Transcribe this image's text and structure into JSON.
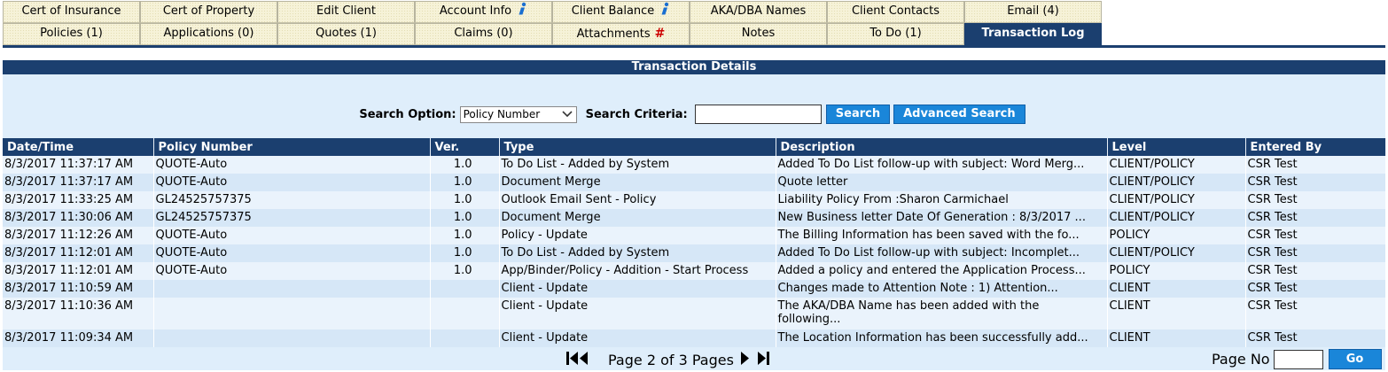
{
  "tabs": {
    "row1": [
      {
        "label": "Cert of Insurance"
      },
      {
        "label": "Cert of Property"
      },
      {
        "label": "Edit Client"
      },
      {
        "label": "Account Info",
        "icon": "info-icon"
      },
      {
        "label": "Client Balance",
        "icon": "info-icon"
      },
      {
        "label": "AKA/DBA Names"
      },
      {
        "label": "Client Contacts"
      },
      {
        "label": "Email (4)"
      }
    ],
    "row2": [
      {
        "label": "Policies (1)"
      },
      {
        "label": "Applications (0)"
      },
      {
        "label": "Quotes (1)"
      },
      {
        "label": "Claims (0)"
      },
      {
        "label": "Attachments",
        "icon": "hash-icon",
        "icon_text": "#"
      },
      {
        "label": "Notes"
      },
      {
        "label": "To Do (1)"
      },
      {
        "label": "Transaction Log",
        "active": true
      }
    ]
  },
  "panel": {
    "title": "Transaction Details",
    "search": {
      "option_label": "Search Option:",
      "option_value": "Policy Number",
      "criteria_label": "Search Criteria:",
      "criteria_value": "",
      "search_button": "Search",
      "advanced_button": "Advanced Search"
    }
  },
  "table": {
    "columns": [
      "Date/Time",
      "Policy Number",
      "Ver.",
      "Type",
      "Description",
      "Level",
      "Entered By"
    ],
    "rows": [
      [
        "8/3/2017 11:37:17 AM",
        "QUOTE-Auto",
        "1.0",
        "To Do List - Added by System",
        "Added To Do List follow-up with subject: Word Merg...",
        "CLIENT/POLICY",
        "CSR Test"
      ],
      [
        "8/3/2017 11:37:17 AM",
        "QUOTE-Auto",
        "1.0",
        "Document Merge",
        "Quote letter",
        "CLIENT/POLICY",
        "CSR Test"
      ],
      [
        "8/3/2017 11:33:25 AM",
        "GL24525757375",
        "1.0",
        "Outlook Email Sent - Policy",
        "Liability Policy From :Sharon Carmichael",
        "CLIENT/POLICY",
        "CSR Test"
      ],
      [
        "8/3/2017 11:30:06 AM",
        "GL24525757375",
        "1.0",
        "Document Merge",
        "New Business letter Date Of Generation : 8/3/2017 ...",
        "CLIENT/POLICY",
        "CSR Test"
      ],
      [
        "8/3/2017 11:12:26 AM",
        "QUOTE-Auto",
        "1.0",
        "Policy - Update",
        "The Billing Information has been saved with the fo...",
        "POLICY",
        "CSR Test"
      ],
      [
        "8/3/2017 11:12:01 AM",
        "QUOTE-Auto",
        "1.0",
        "To Do List - Added by System",
        "Added To Do List follow-up with subject: Incomplet...",
        "CLIENT/POLICY",
        "CSR Test"
      ],
      [
        "8/3/2017 11:12:01 AM",
        "QUOTE-Auto",
        "1.0",
        "App/Binder/Policy - Addition - Start Process",
        "Added a policy and entered the Application Process...",
        "POLICY",
        "CSR Test"
      ],
      [
        "8/3/2017 11:10:59 AM",
        "",
        "",
        "Client - Update",
        "Changes made to Attention Note : 1) Attention...",
        "CLIENT",
        "CSR Test"
      ],
      [
        "8/3/2017 11:10:36 AM",
        "",
        "",
        "Client - Update",
        "The AKA/DBA Name has been added with the following...",
        "CLIENT",
        "CSR Test"
      ],
      [
        "8/3/2017 11:09:34 AM",
        "",
        "",
        "Client - Update",
        "The Location Information has been successfully add...",
        "CLIENT",
        "CSR Test"
      ]
    ]
  },
  "pager": {
    "text": "Page 2 of 3 Pages",
    "page_no_label": "Page No",
    "page_no_value": "",
    "go_button": "Go"
  }
}
